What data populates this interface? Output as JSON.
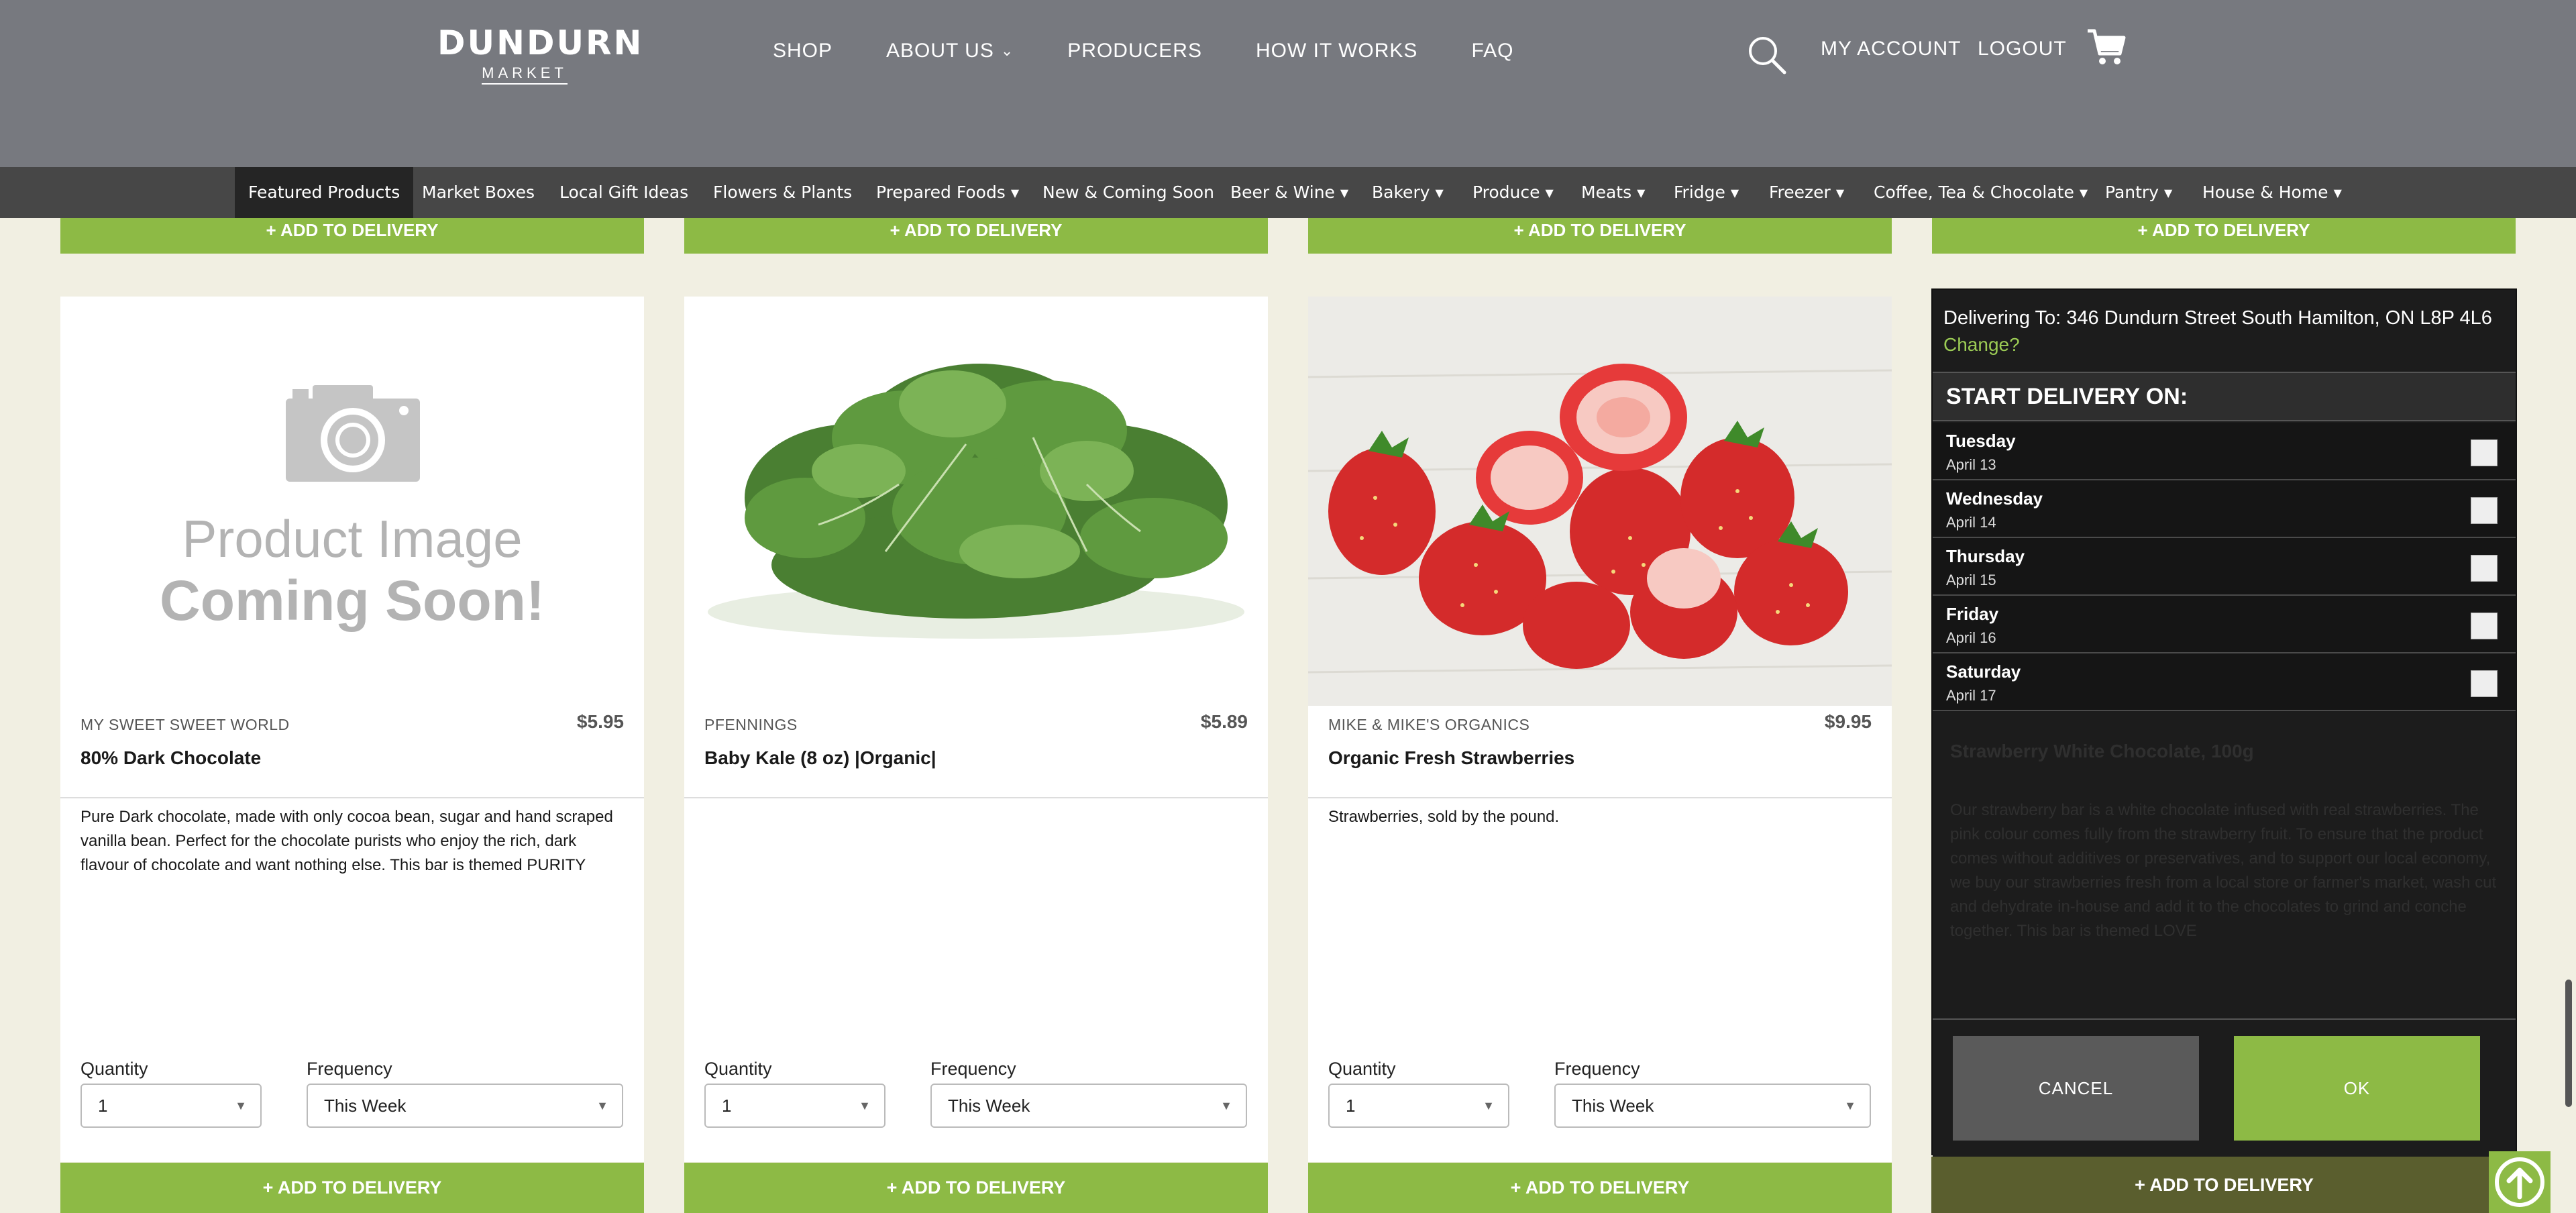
{
  "header": {
    "logo_main": "DUNDURN",
    "logo_sub": "MARKET",
    "nav": [
      {
        "label": "SHOP"
      },
      {
        "label": "ABOUT US"
      },
      {
        "label": "PRODUCERS"
      },
      {
        "label": "HOW IT WORKS"
      },
      {
        "label": "FAQ"
      }
    ],
    "account": "MY ACCOUNT",
    "logout": "LOGOUT"
  },
  "categories": [
    {
      "label": "Featured Products"
    },
    {
      "label": "Market Boxes"
    },
    {
      "label": "Local Gift Ideas"
    },
    {
      "label": "Flowers & Plants"
    },
    {
      "label": "Prepared Foods"
    },
    {
      "label": "New & Coming Soon"
    },
    {
      "label": "Beer & Wine"
    },
    {
      "label": "Bakery"
    },
    {
      "label": "Produce"
    },
    {
      "label": "Meats"
    },
    {
      "label": "Fridge"
    },
    {
      "label": "Freezer"
    },
    {
      "label": "Coffee, Tea & Chocolate"
    },
    {
      "label": "Pantry"
    },
    {
      "label": "House & Home"
    }
  ],
  "add_label": "+ ADD TO DELIVERY",
  "products": [
    {
      "placeholder_line1": "Product Image",
      "placeholder_line2": "Coming Soon!",
      "producer": "MY SWEET SWEET WORLD",
      "price": "$5.95",
      "title": "80% Dark Chocolate",
      "description": "Pure Dark chocolate, made with only cocoa bean, sugar and hand scraped vanilla bean. Perfect for the chocolate purists who enjoy the rich, dark flavour of chocolate and want nothing else. This bar is themed PURITY",
      "quantity_label": "Quantity",
      "quantity": "1",
      "frequency_label": "Frequency",
      "frequency": "This Week"
    },
    {
      "producer": "PFENNINGS",
      "price": "$5.89",
      "title": "Baby Kale (8 oz) |Organic|",
      "description": "",
      "quantity_label": "Quantity",
      "quantity": "1",
      "frequency_label": "Frequency",
      "frequency": "This Week"
    },
    {
      "producer": "MIKE & MIKE'S ORGANICS",
      "price": "$9.95",
      "title": "Organic Fresh Strawberries",
      "description": "Strawberries, sold by the pound.",
      "quantity_label": "Quantity",
      "quantity": "1",
      "frequency_label": "Frequency",
      "frequency": "This Week"
    }
  ],
  "delivery_panel": {
    "address": "Delivering To: 346 Dundurn Street South Hamilton, ON L8P 4L6",
    "change": "Change?",
    "heading": "START DELIVERY ON:",
    "days": [
      {
        "day": "Tuesday",
        "date": "April 13"
      },
      {
        "day": "Wednesday",
        "date": "April 14"
      },
      {
        "day": "Thursday",
        "date": "April 15"
      },
      {
        "day": "Friday",
        "date": "April 16"
      },
      {
        "day": "Saturday",
        "date": "April 17"
      }
    ],
    "background_product_title": "Strawberry White Chocolate, 100g",
    "background_product_desc": "Our strawberry bar is a white chocolate infused with real strawberries. The pink colour comes fully from the strawberry fruit. To ensure that the product comes without additives or preservatives, and to support our local economy, we buy our strawberries fresh from a local store or farmer's market, wash cut and dehydrate in-house and add it to the chocolates to grind and conche together. This bar is themed LOVE",
    "cancel": "CANCEL",
    "ok": "OK"
  },
  "colors": {
    "header_bg": "#77797f",
    "category_bar": "#474747",
    "accent_green": "#8dba45",
    "page_bg": "#f1efe2"
  }
}
